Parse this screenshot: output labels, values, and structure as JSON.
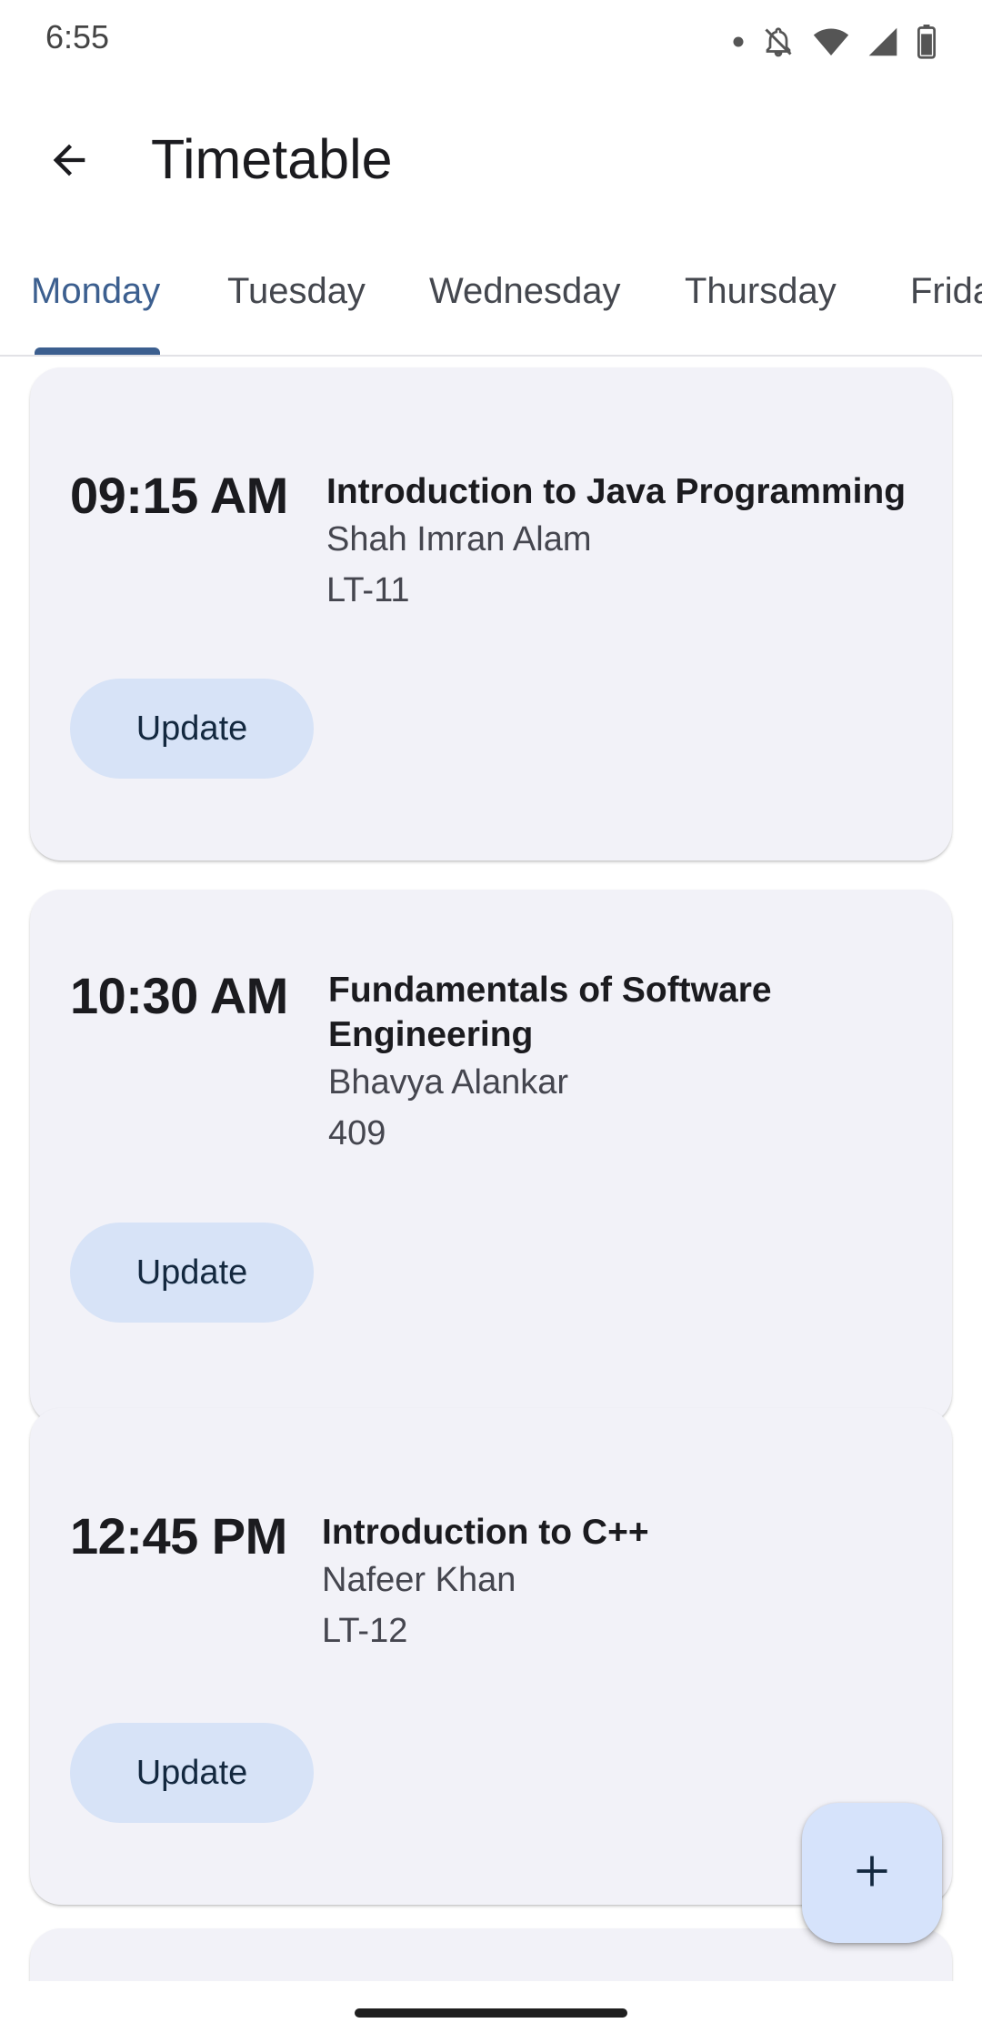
{
  "status_bar": {
    "time": "6:55",
    "icons": [
      "dot-icon",
      "bell-off-icon",
      "wifi-icon",
      "signal-icon",
      "battery-icon"
    ]
  },
  "app_bar": {
    "title": "Timetable",
    "back_icon": "arrow-back-icon"
  },
  "tabs": [
    {
      "label": "Monday",
      "selected": true
    },
    {
      "label": "Tuesday",
      "selected": false
    },
    {
      "label": "Wednesday",
      "selected": false
    },
    {
      "label": "Thursday",
      "selected": false
    },
    {
      "label": "Frida",
      "selected": false
    }
  ],
  "classes": [
    {
      "time": "09:15 AM",
      "title": "Introduction to Java Programming",
      "instructor": "Shah Imran Alam",
      "room": "LT-11",
      "button": "Update"
    },
    {
      "time": "10:30 AM",
      "title": "Fundamentals of Software Engineering",
      "instructor": "Bhavya Alankar",
      "room": "409",
      "button": "Update"
    },
    {
      "time": "12:45 PM",
      "title": "Introduction to C++",
      "instructor": "Nafeer Khan",
      "room": "LT-12",
      "button": "Update"
    }
  ],
  "fab": {
    "icon": "plus-icon"
  },
  "colors": {
    "accent": "#3c5f8f",
    "card_background": "#f2f2f8",
    "button_background": "#d7e3f7",
    "fab_background": "#d6e3fb"
  }
}
